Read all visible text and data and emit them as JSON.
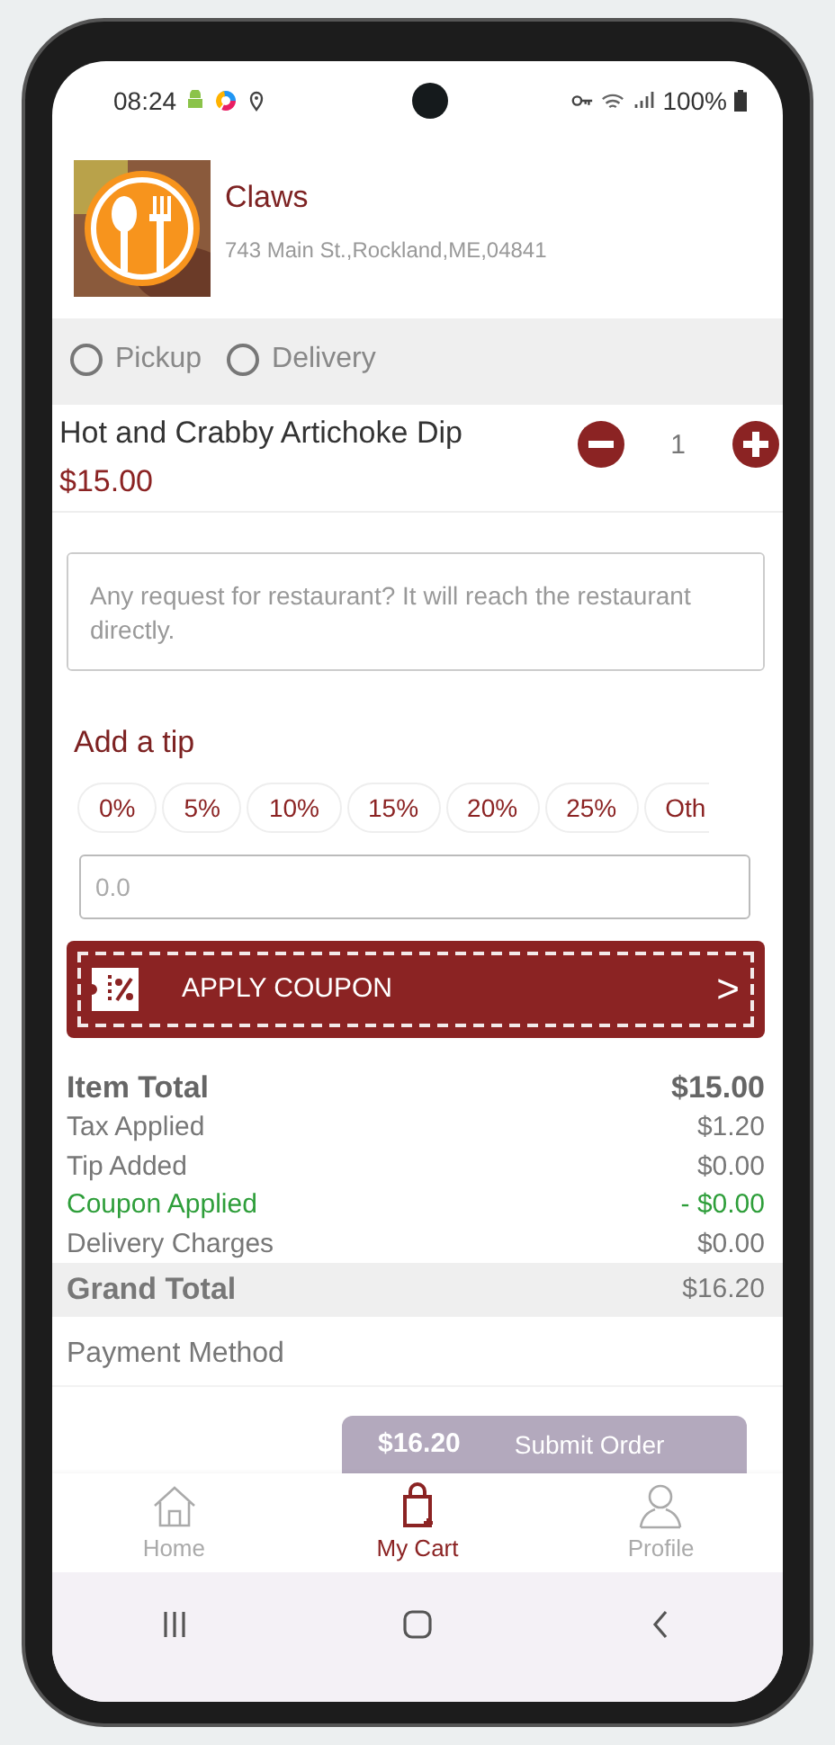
{
  "status_bar": {
    "time": "08:24",
    "battery": "100%"
  },
  "restaurant": {
    "name": "Claws",
    "address": "743 Main St.,Rockland,ME,04841"
  },
  "order_types": [
    {
      "label": "Pickup",
      "selected": false
    },
    {
      "label": "Delivery",
      "selected": false
    }
  ],
  "item": {
    "name": "Hot and Crabby Artichoke Dip",
    "price": "$15.00",
    "quantity": "1"
  },
  "request_field": {
    "placeholder": "Any request for restaurant? It will reach the restaurant directly."
  },
  "tip": {
    "title": "Add a tip",
    "options": [
      {
        "label": "0%",
        "selected": false
      },
      {
        "label": "5%",
        "selected": false
      },
      {
        "label": "10%",
        "selected": false
      },
      {
        "label": "15%",
        "selected": false
      },
      {
        "label": "20%",
        "selected": false
      },
      {
        "label": "25%",
        "selected": false
      },
      {
        "label": "Oth",
        "selected": false
      }
    ],
    "field": {
      "placeholder": "0.0"
    }
  },
  "coupon_button": {
    "label": "APPLY COUPON",
    "arrow": ">"
  },
  "totals": [
    {
      "kind": "main",
      "label": "Item Total",
      "value": "$15.00"
    },
    {
      "kind": "plain",
      "label": "Tax Applied",
      "value": "$1.20"
    },
    {
      "kind": "plain",
      "label": "Tip Added",
      "value": "$0.00"
    },
    {
      "kind": "discount",
      "label": "Coupon Applied",
      "value": "- $0.00"
    },
    {
      "kind": "plain",
      "label": "Delivery Charges",
      "value": "$0.00"
    },
    {
      "kind": "grand",
      "label": "Grand Total",
      "value": "$16.20"
    }
  ],
  "payment_method": {
    "label": "Payment Method"
  },
  "submit_button": {
    "amount": "$16.20",
    "label": "Submit Order"
  },
  "bottom_nav": [
    {
      "label": "Home",
      "kind": "home",
      "selected": false
    },
    {
      "label": "My Cart",
      "kind": "cart",
      "selected": true
    },
    {
      "label": "Profile",
      "kind": "profile",
      "selected": false
    }
  ]
}
